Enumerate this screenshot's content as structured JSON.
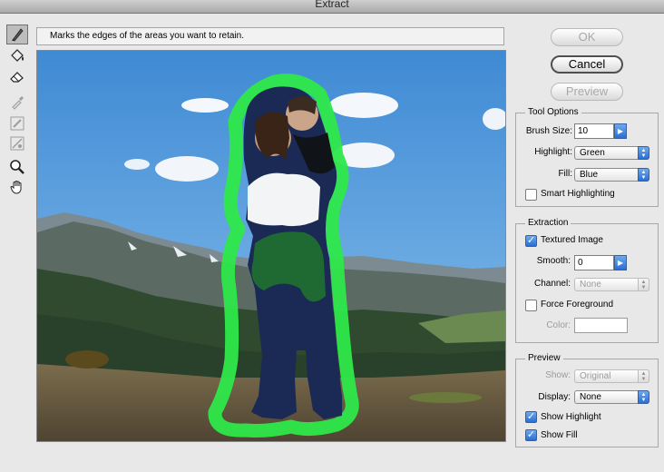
{
  "window": {
    "title": "Extract"
  },
  "hint": "Marks the edges of the areas you want to retain.",
  "tools": [
    {
      "name": "edge-highlighter-tool",
      "icon": "highlighter-icon",
      "active": true,
      "enabled": true
    },
    {
      "name": "fill-tool",
      "icon": "paint-bucket-icon",
      "active": false,
      "enabled": true
    },
    {
      "name": "eraser-tool",
      "icon": "eraser-icon",
      "active": false,
      "enabled": true
    },
    {
      "name": "eyedropper-tool",
      "icon": "eyedropper-icon",
      "active": false,
      "enabled": false
    },
    {
      "name": "cleanup-tool",
      "icon": "cleanup-icon",
      "active": false,
      "enabled": false
    },
    {
      "name": "edge-touchup-tool",
      "icon": "edge-touchup-icon",
      "active": false,
      "enabled": false
    },
    {
      "name": "zoom-tool",
      "icon": "magnifier-icon",
      "active": false,
      "enabled": true
    },
    {
      "name": "hand-tool",
      "icon": "hand-icon",
      "active": false,
      "enabled": true
    }
  ],
  "buttons": {
    "ok": "OK",
    "cancel": "Cancel",
    "preview": "Preview"
  },
  "tool_options": {
    "title": "Tool Options",
    "brush_size_label": "Brush Size:",
    "brush_size_value": "10",
    "highlight_label": "Highlight:",
    "highlight_value": "Green",
    "fill_label": "Fill:",
    "fill_value": "Blue",
    "smart_highlighting_label": "Smart Highlighting",
    "smart_highlighting_checked": false
  },
  "extraction": {
    "title": "Extraction",
    "textured_label": "Textured Image",
    "textured_checked": true,
    "smooth_label": "Smooth:",
    "smooth_value": "0",
    "channel_label": "Channel:",
    "channel_value": "None",
    "force_foreground_label": "Force Foreground",
    "force_foreground_checked": false,
    "color_label": "Color:"
  },
  "preview": {
    "title": "Preview",
    "show_label": "Show:",
    "show_value": "Original",
    "display_label": "Display:",
    "display_value": "None",
    "show_highlight_label": "Show Highlight",
    "show_highlight_checked": true,
    "show_fill_label": "Show Fill",
    "show_fill_checked": true
  },
  "colors": {
    "highlight": "#2ee84a",
    "stepper": "#2a6ed3",
    "sky": "#5aa2df"
  }
}
